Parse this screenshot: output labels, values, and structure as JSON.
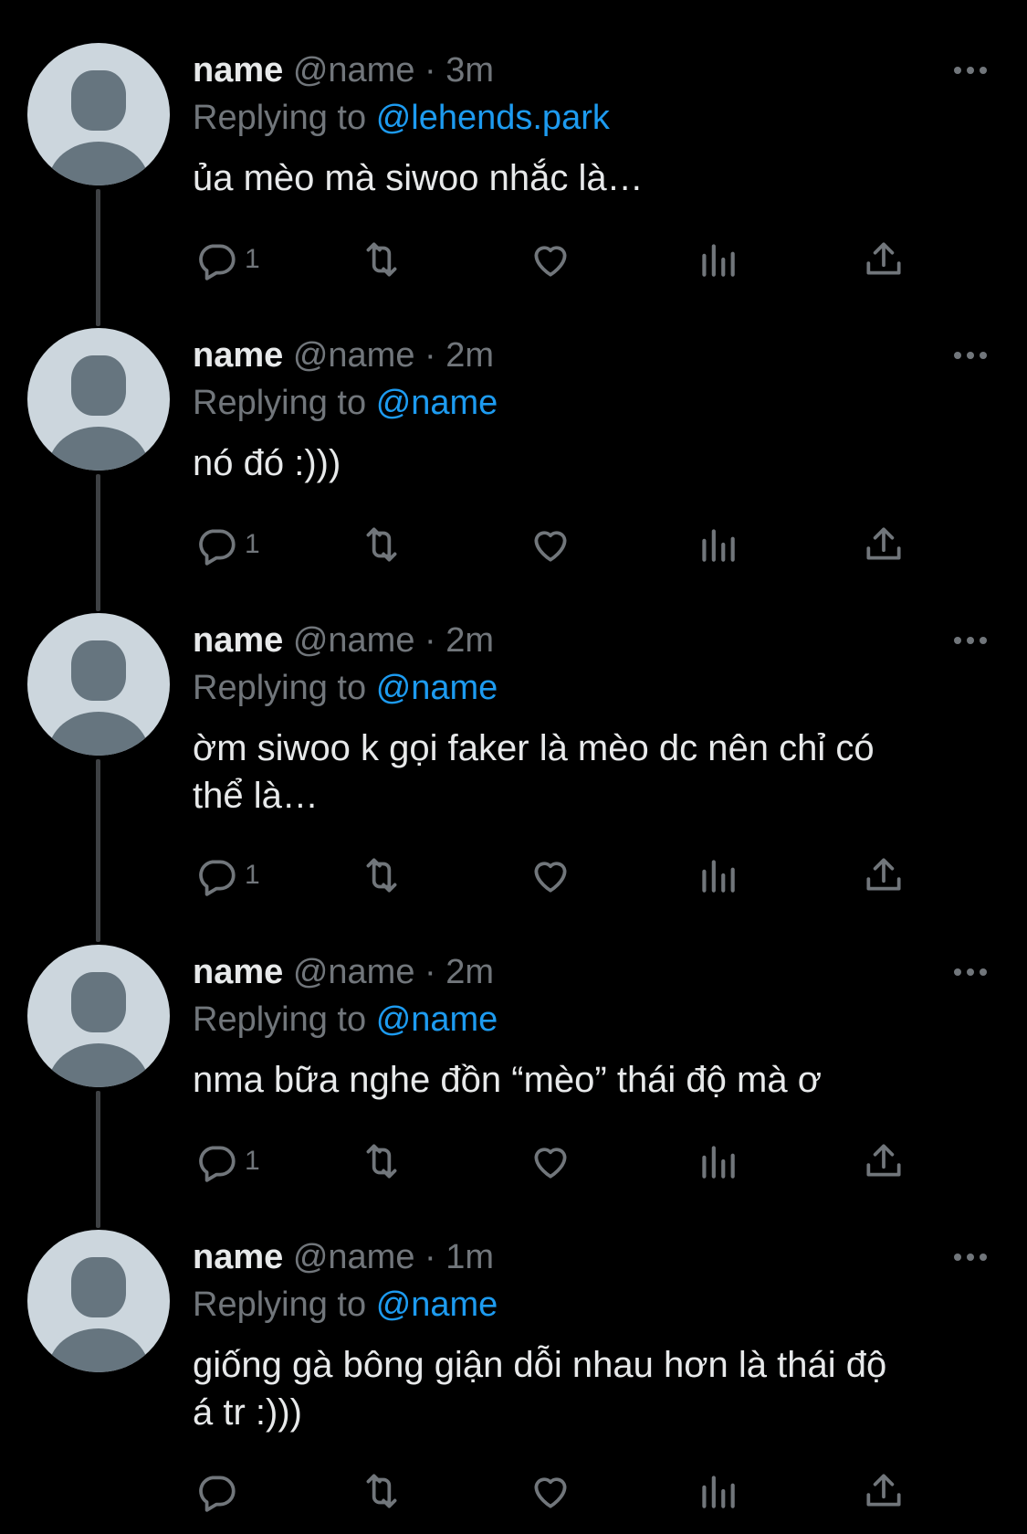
{
  "tweets": [
    {
      "display_name": "name",
      "handle": "@name",
      "separator": "·",
      "time": "3m",
      "replying_label": "Replying to",
      "reply_to": "@lehends.park",
      "text": "ủa mèo mà siwoo nhắc là…",
      "reply_count": "1"
    },
    {
      "display_name": "name",
      "handle": "@name",
      "separator": "·",
      "time": "2m",
      "replying_label": "Replying to",
      "reply_to": "@name",
      "text": "nó đó :)))",
      "reply_count": "1"
    },
    {
      "display_name": "name",
      "handle": "@name",
      "separator": "·",
      "time": "2m",
      "replying_label": "Replying to",
      "reply_to": "@name",
      "text": "ờm siwoo k gọi faker là mèo dc nên chỉ có\nthể là…",
      "reply_count": "1"
    },
    {
      "display_name": "name",
      "handle": "@name",
      "separator": "·",
      "time": "2m",
      "replying_label": "Replying to",
      "reply_to": "@name",
      "text": "nma bữa nghe đồn “mèo” thái độ mà ơ",
      "reply_count": "1"
    },
    {
      "display_name": "name",
      "handle": "@name",
      "separator": "·",
      "time": "1m",
      "replying_label": "Replying to",
      "reply_to": "@name",
      "text": "giống gà bông giận dỗi nhau hơn là thái độ\ná tr :)))",
      "reply_count": ""
    }
  ],
  "icons": {
    "reply": "reply-icon",
    "retweet": "retweet-icon",
    "like": "heart-icon",
    "views": "analytics-icon",
    "share": "share-icon",
    "more": "more-icon"
  },
  "colors": {
    "background": "#000000",
    "primary_text": "#e7e9ea",
    "secondary_text": "#71767b",
    "link": "#1d9bf0",
    "avatar_bg": "#ccd6dd",
    "avatar_fg": "#66757f"
  }
}
